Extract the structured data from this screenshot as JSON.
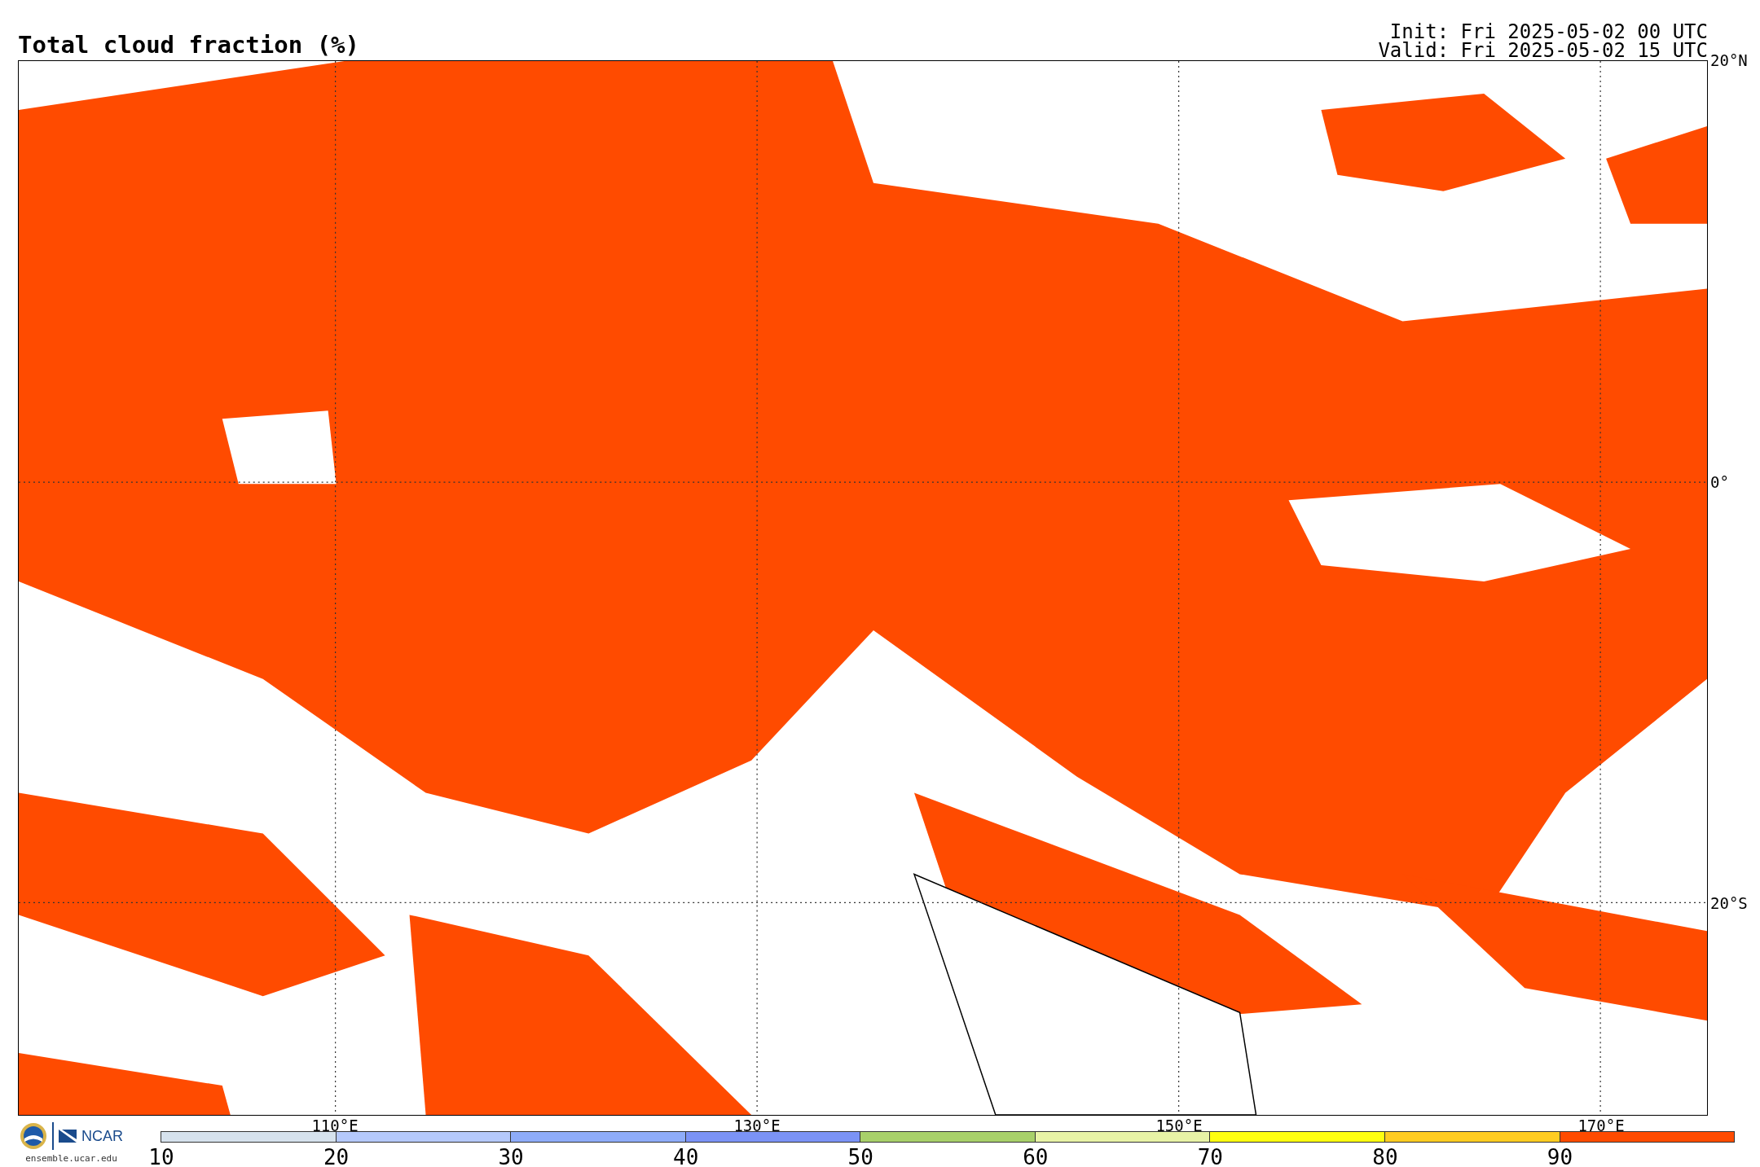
{
  "title": "Total cloud fraction (%)",
  "init": "Init: Fri 2025-05-02 00 UTC",
  "valid": "Valid: Fri 2025-05-02 15 UTC",
  "lat_labels": [
    "20°N",
    "0°",
    "20°S"
  ],
  "lon_labels": [
    "110°E",
    "130°E",
    "150°E",
    "170°E"
  ],
  "logo": {
    "name": "NCAR",
    "url": "ensemble.ucar.edu"
  },
  "colorbar": [
    {
      "label": "10",
      "color": "#d6e2ed"
    },
    {
      "label": "20",
      "color": "#b5c9fb"
    },
    {
      "label": "30",
      "color": "#8eacf9"
    },
    {
      "label": "40",
      "color": "#7b93f6"
    },
    {
      "label": "50",
      "color": "#a8d06a"
    },
    {
      "label": "60",
      "color": "#e8f3a6"
    },
    {
      "label": "70",
      "color": "#ffff10"
    },
    {
      "label": "80",
      "color": "#ffcc22"
    },
    {
      "label": "90",
      "color": "#ff4b00"
    }
  ]
}
